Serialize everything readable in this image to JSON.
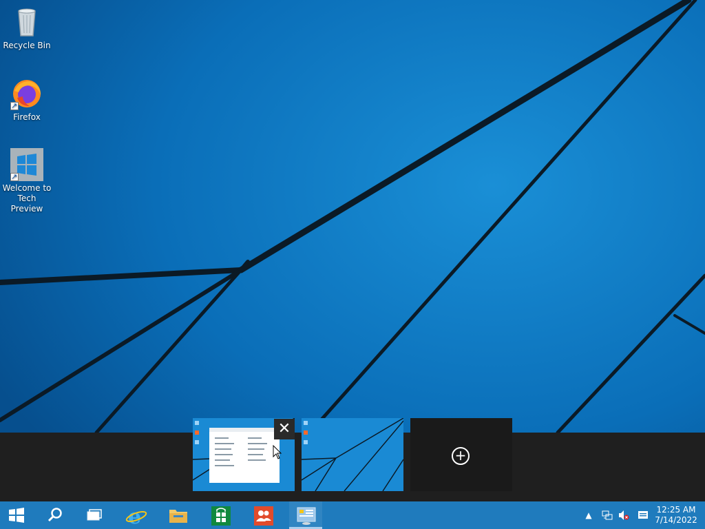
{
  "desktop": {
    "icons": [
      {
        "label": "Recycle Bin",
        "icon": "recycle-bin-icon"
      },
      {
        "label": "Firefox",
        "icon": "firefox-icon"
      },
      {
        "label": "Welcome to Tech Preview",
        "icon": "windows-logo-icon"
      }
    ]
  },
  "task_view": {
    "desktops": [
      "desktop-1",
      "desktop-2"
    ],
    "close_symbol": "✕",
    "add_symbol": "+"
  },
  "taskbar": {
    "buttons": [
      "start-button",
      "search-button",
      "task-view-button",
      "internet-explorer-button",
      "file-explorer-button",
      "store-button",
      "people-app-button",
      "control-panel-button"
    ]
  },
  "tray": {
    "time": "12:25 AM",
    "date": "7/14/2022",
    "icons": [
      "show-hidden-icons-chevron",
      "network-icon",
      "volume-muted-icon",
      "action-center-icon"
    ]
  },
  "colors": {
    "wallpaper": "#0a6fb8",
    "taskbar": "#1f7bbd",
    "task_view_strip": "#1f1f1f"
  }
}
